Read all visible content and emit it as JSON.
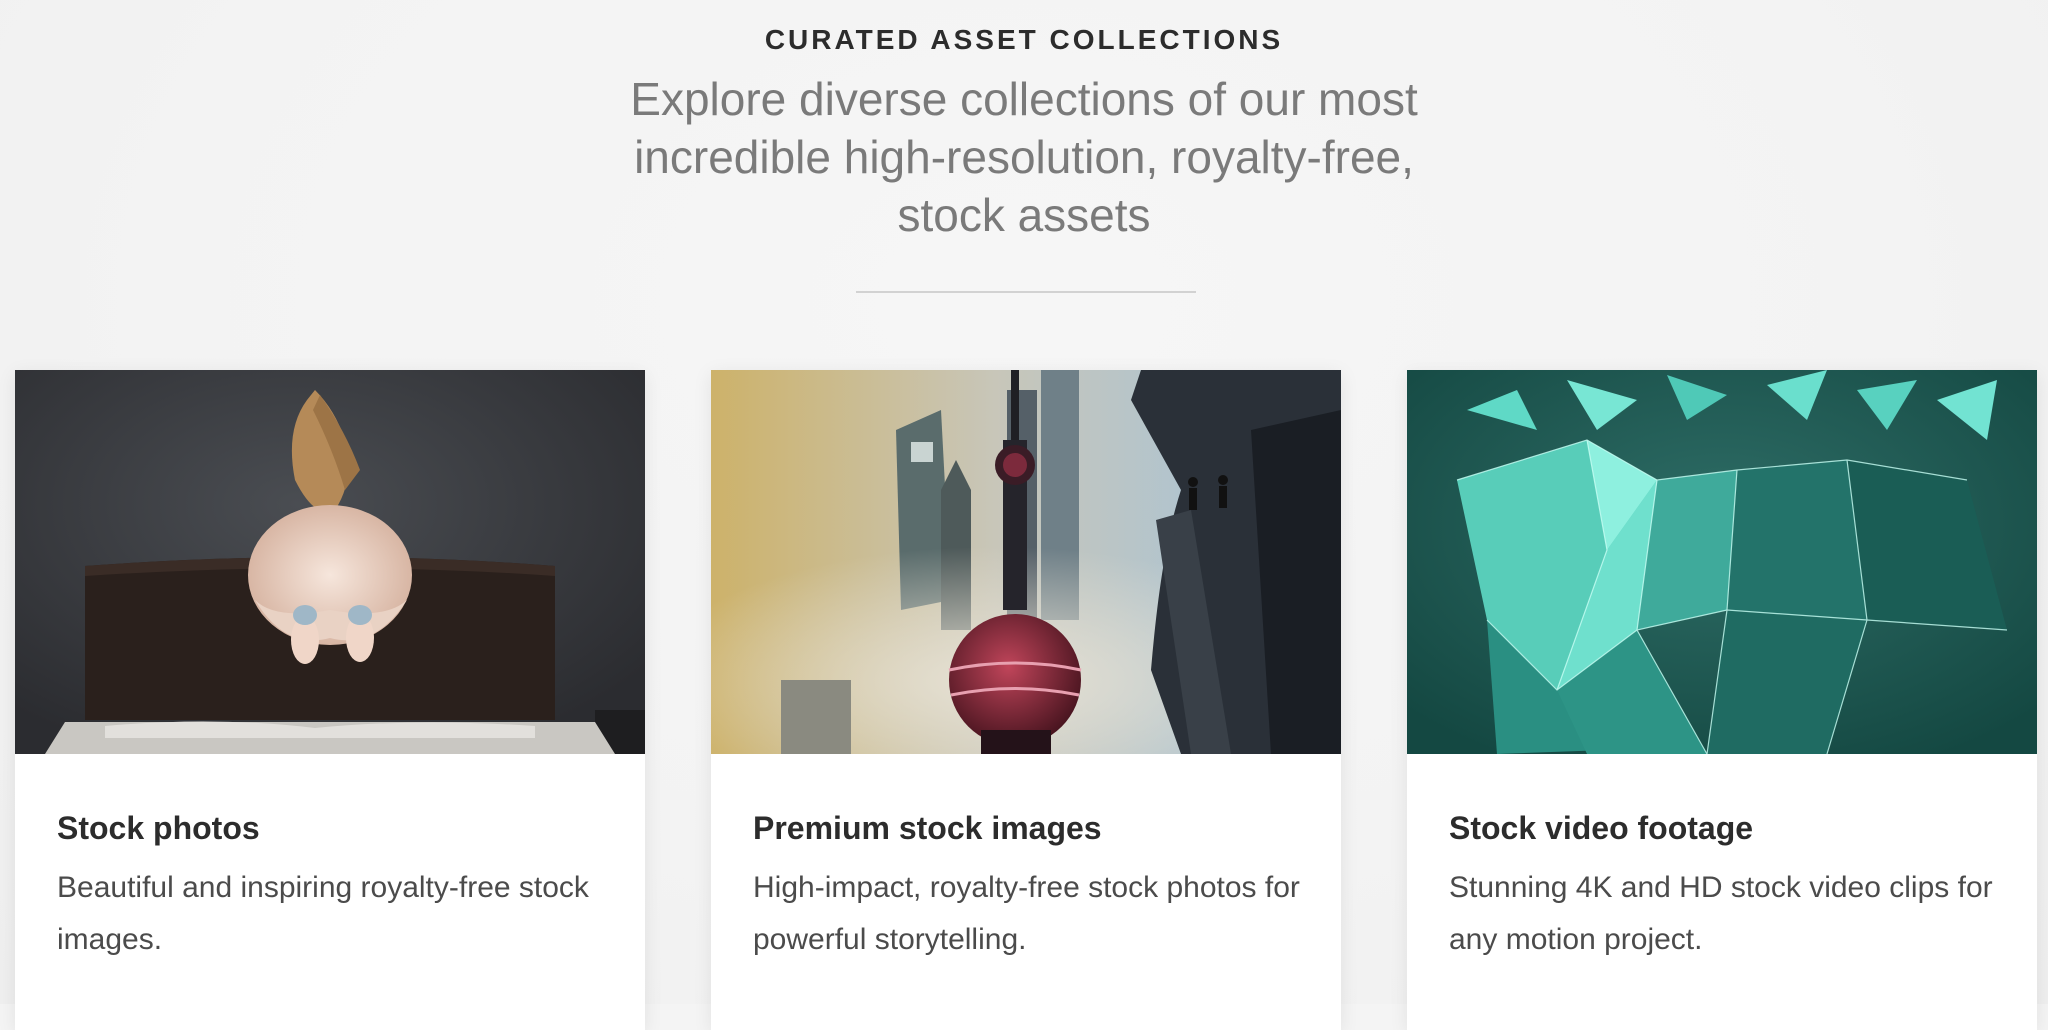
{
  "section": {
    "eyebrow": "CURATED ASSET COLLECTIONS",
    "headline": "Explore diverse collections of our most incredible high-resolution, royalty-free, stock assets"
  },
  "cards": [
    {
      "title": "Stock photos",
      "description": "Beautiful and inspiring royalty-free stock images.",
      "image_icon": "jumping-girl-photo"
    },
    {
      "title": "Premium stock images",
      "description": "High-impact, royalty-free stock photos for powerful storytelling.",
      "image_icon": "city-tower-photo"
    },
    {
      "title": "Stock video footage",
      "description": "Stunning 4K and HD stock video clips for any motion project.",
      "image_icon": "polygon-face-photo"
    }
  ],
  "colors": {
    "background": "#f4f4f4",
    "card_background": "#ffffff",
    "title_text": "#2c2c2c",
    "headline_text": "#7a7a7a",
    "teal_accent": "#2fa89c"
  }
}
